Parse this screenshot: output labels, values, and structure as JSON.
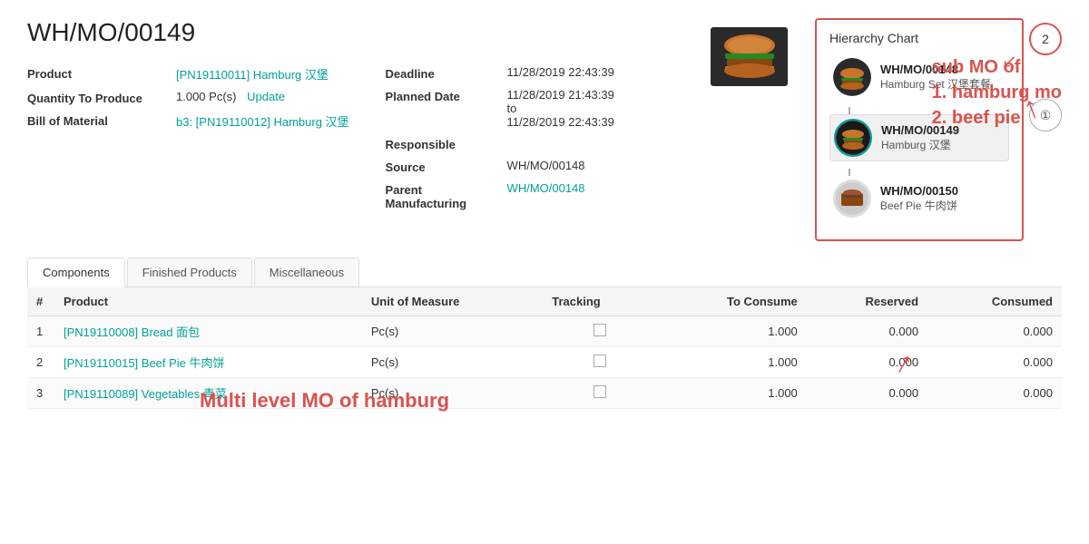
{
  "title": "WH/MO/00149",
  "form": {
    "product_label": "Product",
    "product_value": "[PN19110011] Hamburg 汉堡",
    "qty_label": "Quantity To Produce",
    "qty_value": "1.000 Pc(s)",
    "qty_update": "Update",
    "bom_label": "Bill of Material",
    "bom_value": "b3: [PN19110012] Hamburg 汉堡",
    "deadline_label": "Deadline",
    "deadline_value": "11/28/2019 22:43:39",
    "planned_date_label": "Planned Date",
    "planned_date_value": "11/28/2019 21:43:39",
    "planned_date_to": "to",
    "planned_date_end": "11/28/2019 22:43:39",
    "responsible_label": "Responsible",
    "responsible_value": "",
    "source_label": "Source",
    "source_value": "WH/MO/00148",
    "parent_mfg_label": "Parent Manufacturing",
    "parent_mfg_value": "WH/MO/00148"
  },
  "hierarchy": {
    "title": "Hierarchy Chart",
    "items": [
      {
        "id": "WH/MO/00148",
        "name": "Hamburg Set 汉堡套餐",
        "active": false
      },
      {
        "id": "WH/MO/00149",
        "name": "Hamburg 汉堡",
        "active": true
      },
      {
        "id": "WH/MO/00150",
        "name": "Beef Pie 牛肉饼",
        "active": false
      }
    ]
  },
  "badges": {
    "first": "2",
    "second": "①"
  },
  "tabs": [
    {
      "label": "Components",
      "active": true
    },
    {
      "label": "Finished Products",
      "active": false
    },
    {
      "label": "Miscellaneous",
      "active": false
    }
  ],
  "table": {
    "columns": [
      "#",
      "Product",
      "Unit of Measure",
      "Tracking",
      "To Consume",
      "Reserved",
      "Consumed"
    ],
    "rows": [
      {
        "num": "1",
        "product": "[PN19110008] Bread 面包",
        "uom": "Pc(s)",
        "tracking": "",
        "to_consume": "1.000",
        "reserved": "0.000",
        "consumed": "0.000"
      },
      {
        "num": "2",
        "product": "[PN19110015] Beef Pie 牛肉饼",
        "uom": "Pc(s)",
        "tracking": "",
        "to_consume": "1.000",
        "reserved": "0.000",
        "consumed": "0.000"
      },
      {
        "num": "3",
        "product": "[PN19110089] Vegetables 青菜",
        "uom": "Pc(s)",
        "tracking": "",
        "to_consume": "1.000",
        "reserved": "0.000",
        "consumed": "0.000"
      }
    ]
  },
  "annotations": {
    "multilevel": "Multi level MO of  hamburg",
    "submo_title": "sub MO of",
    "submo_1": "1. hamburg mo",
    "submo_2": "2. beef pie"
  }
}
